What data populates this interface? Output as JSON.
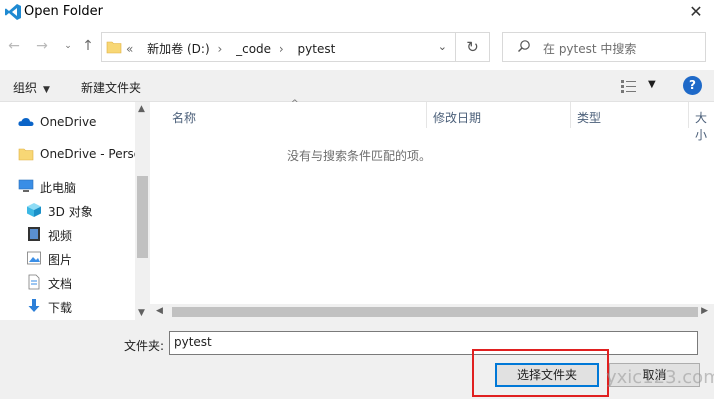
{
  "window": {
    "title": "Open Folder"
  },
  "nav": {
    "breadcrumb": [
      "«",
      "新加卷 (D:)",
      "_code",
      "pytest"
    ],
    "search_placeholder": "在 pytest 中搜索"
  },
  "toolbar": {
    "organize_label": "组织",
    "new_folder_label": "新建文件夹"
  },
  "sidebar": {
    "items": [
      {
        "label": "OneDrive",
        "icon": "cloud-icon"
      },
      {
        "label": "OneDrive - Personal",
        "icon": "folder-icon"
      },
      {
        "label": "此电脑",
        "icon": "computer-icon"
      },
      {
        "label": "3D 对象",
        "icon": "cube-icon"
      },
      {
        "label": "视频",
        "icon": "video-icon"
      },
      {
        "label": "图片",
        "icon": "picture-icon"
      },
      {
        "label": "文档",
        "icon": "document-icon"
      },
      {
        "label": "下载",
        "icon": "download-icon"
      }
    ]
  },
  "columns": [
    "名称",
    "修改日期",
    "类型",
    "大小"
  ],
  "empty_message": "没有与搜索条件匹配的项。",
  "bottom": {
    "filename_label": "文件夹:",
    "filename_value": "pytest",
    "select_button": "选择文件夹",
    "cancel_button": "取消"
  },
  "watermark": "yxic123.com",
  "colors": {
    "accent": "#0078d7",
    "highlight": "#e02020",
    "help": "#1e69c8"
  }
}
